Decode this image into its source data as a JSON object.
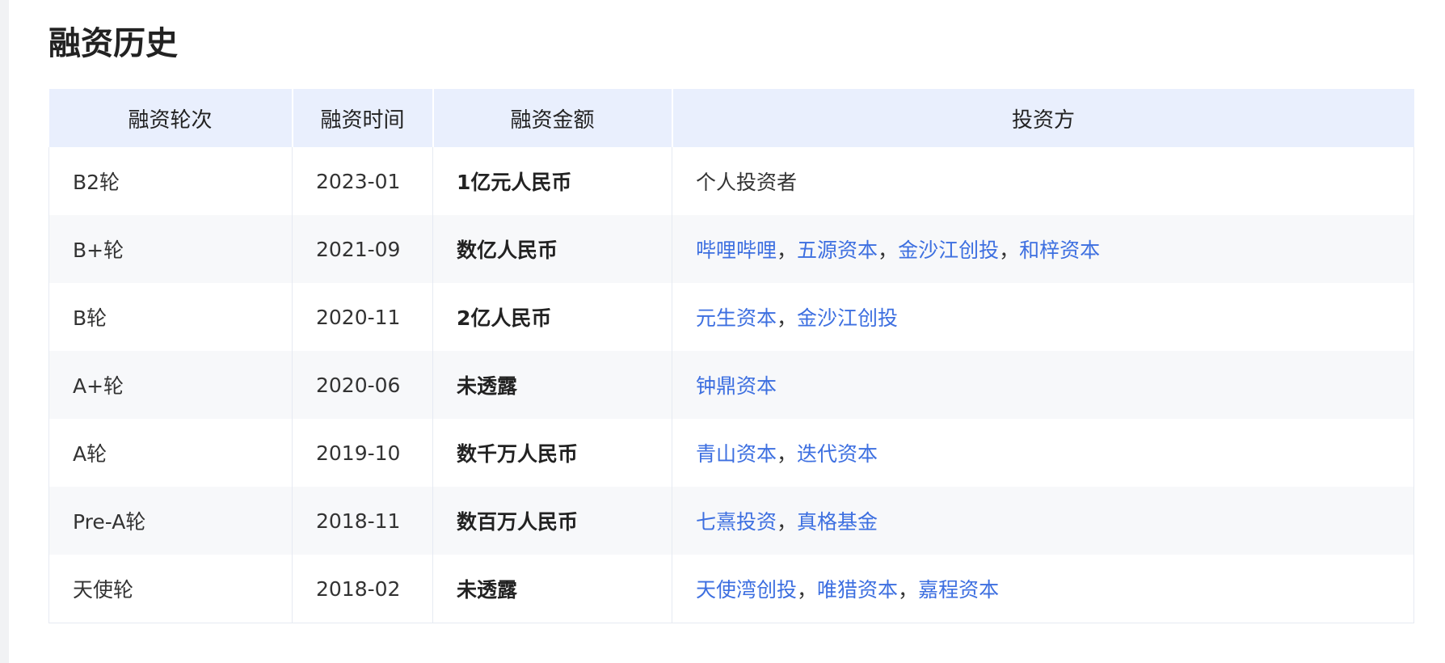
{
  "title": "融资历史",
  "headers": [
    "融资轮次",
    "融资时间",
    "融资金额",
    "投资方"
  ],
  "rows": [
    {
      "round": "B2轮",
      "date": "2023-01",
      "amount": "1亿元人民币",
      "investors": [
        "个人投资者"
      ],
      "investors_linked": false
    },
    {
      "round": "B+轮",
      "date": "2021-09",
      "amount": "数亿人民币",
      "investors": [
        "哔哩哔哩",
        "五源资本",
        "金沙江创投",
        "和梓资本"
      ],
      "investors_linked": true
    },
    {
      "round": "B轮",
      "date": "2020-11",
      "amount": "2亿人民币",
      "investors": [
        "元生资本",
        "金沙江创投"
      ],
      "investors_linked": true
    },
    {
      "round": "A+轮",
      "date": "2020-06",
      "amount": "未透露",
      "investors": [
        "钟鼎资本"
      ],
      "investors_linked": true
    },
    {
      "round": "A轮",
      "date": "2019-10",
      "amount": "数千万人民币",
      "investors": [
        "青山资本",
        "迭代资本"
      ],
      "investors_linked": true
    },
    {
      "round": "Pre-A轮",
      "date": "2018-11",
      "amount": "数百万人民币",
      "investors": [
        "七熹投资",
        "真格基金"
      ],
      "investors_linked": true
    },
    {
      "round": "天使轮",
      "date": "2018-02",
      "amount": "未透露",
      "investors": [
        "天使湾创投",
        "唯猎资本",
        "嘉程资本"
      ],
      "investors_linked": true
    }
  ],
  "separator": "，",
  "colors": {
    "link": "#3d6fe0",
    "header_bg": "#e9effd",
    "stripe_bg": "#f7f8fa"
  }
}
